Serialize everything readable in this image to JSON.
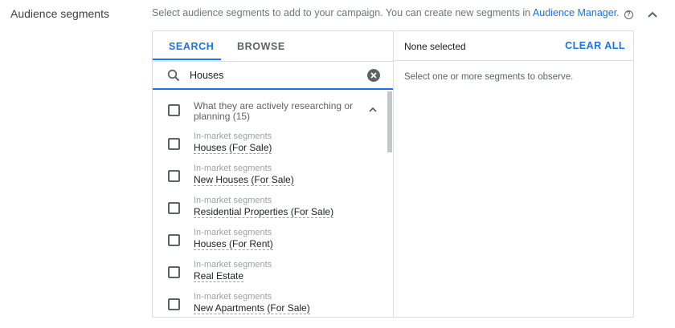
{
  "section": {
    "label": "Audience segments",
    "description": "Select audience segments to add to your campaign. You can create new segments in ",
    "link_text": "Audience Manager",
    "link_suffix": ".",
    "help_icon": "?"
  },
  "tabs": [
    {
      "label": "SEARCH",
      "active": true
    },
    {
      "label": "BROWSE",
      "active": false
    }
  ],
  "search": {
    "value": "Houses",
    "placeholder": ""
  },
  "group": {
    "title": "What they are actively researching or planning (15)",
    "expanded": true
  },
  "results": [
    {
      "category": "In-market segments",
      "name": "Houses (For Sale)",
      "checked": false
    },
    {
      "category": "In-market segments",
      "name": "New Houses (For Sale)",
      "checked": false
    },
    {
      "category": "In-market segments",
      "name": "Residential Properties (For Sale)",
      "checked": false
    },
    {
      "category": "In-market segments",
      "name": "Houses (For Rent)",
      "checked": false
    },
    {
      "category": "In-market segments",
      "name": "Real Estate",
      "checked": false
    },
    {
      "category": "In-market segments",
      "name": "New Apartments (For Sale)",
      "checked": false
    }
  ],
  "selection": {
    "status": "None selected",
    "clear_all_label": "CLEAR ALL",
    "empty_hint": "Select one or more segments to observe."
  },
  "colors": {
    "accent": "#1a73e8",
    "border": "#dadce0",
    "muted_text": "#5f6368"
  }
}
